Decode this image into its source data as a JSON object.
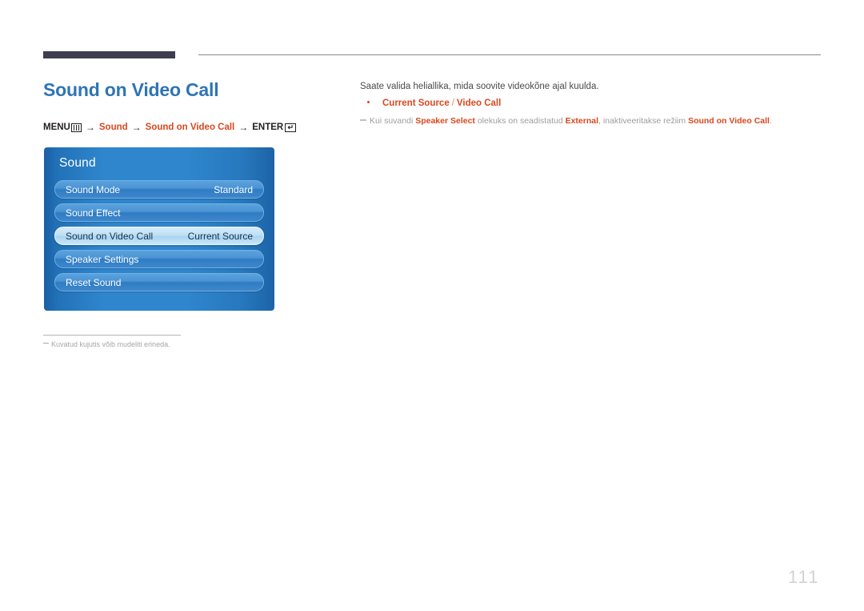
{
  "page": {
    "title": "Sound on Video Call",
    "number": "111"
  },
  "breadcrumb": {
    "menu_label": "MENU",
    "menu_icon": "menu-grid-icon",
    "arrow": "→",
    "step1": "Sound",
    "step2": "Sound on Video Call",
    "enter_label": "ENTER",
    "enter_icon": "enter-return-icon",
    "enter_glyph": "↵"
  },
  "osd": {
    "title": "Sound",
    "rows": [
      {
        "label": "Sound Mode",
        "value": "Standard",
        "selected": false
      },
      {
        "label": "Sound Effect",
        "value": "",
        "selected": false
      },
      {
        "label": "Sound on Video Call",
        "value": "Current Source",
        "selected": true
      },
      {
        "label": "Speaker Settings",
        "value": "",
        "selected": false
      },
      {
        "label": "Reset Sound",
        "value": "",
        "selected": false
      }
    ]
  },
  "image_footnote": "Kuvatud kujutis võib mudeliti erineda.",
  "content": {
    "lead": "Saate valida heliallika, mida soovite videokõne ajal kuulda.",
    "option": {
      "first": "Current Source",
      "separator": "/",
      "second": "Video Call"
    },
    "note": {
      "p1": "Kui suvandi ",
      "b1": "Speaker Select",
      "p2": " olekuks on seadistatud ",
      "b2": "External",
      "p3": ", inaktiveeritakse režiim ",
      "b3": "Sound on Video Call",
      "p4": "."
    }
  },
  "colors": {
    "title_blue": "#2e74b5",
    "accent_orange": "#d9471f",
    "header_bar": "#3e3d4f",
    "osd_blue": "#2f86cd",
    "page_number": "#d3d3d3"
  }
}
